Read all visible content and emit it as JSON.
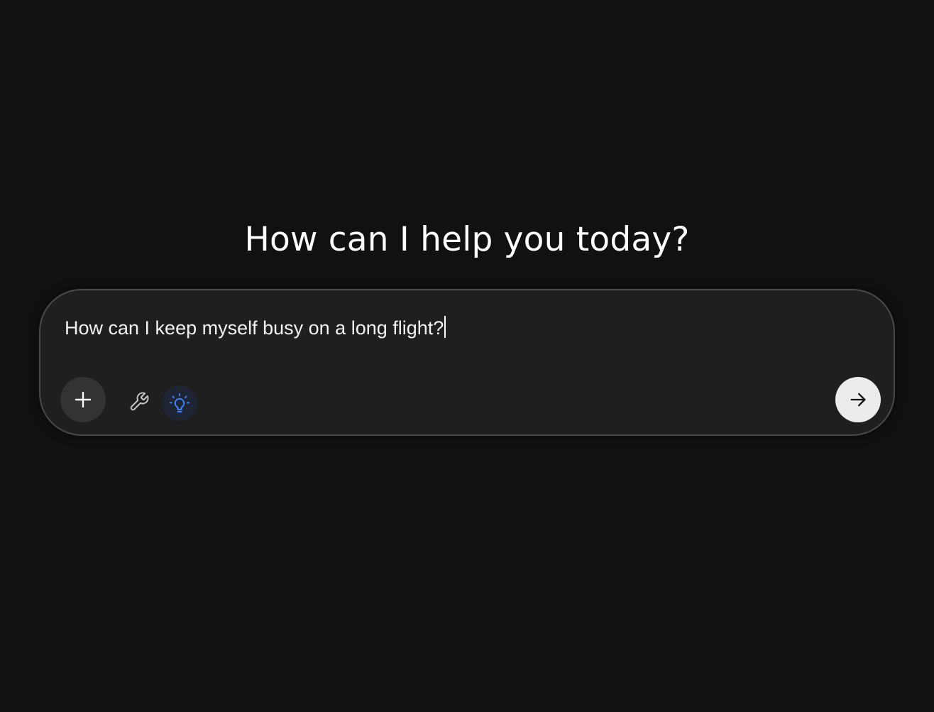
{
  "heading": {
    "title": "How can I help you today?"
  },
  "composer": {
    "input_value": "How can I keep myself busy on a long flight?",
    "buttons": {
      "add": {
        "icon": "plus-icon"
      },
      "tools": {
        "icon": "wrench-icon"
      },
      "think": {
        "icon": "lightbulb-icon",
        "active": true
      },
      "send": {
        "icon": "arrow-right-icon"
      }
    }
  },
  "colors": {
    "background": "#111111",
    "composer_background": "#1f1f1f",
    "composer_border": "#4a4a4a",
    "accent_blue": "#3b82f6",
    "send_button": "#ececec"
  }
}
